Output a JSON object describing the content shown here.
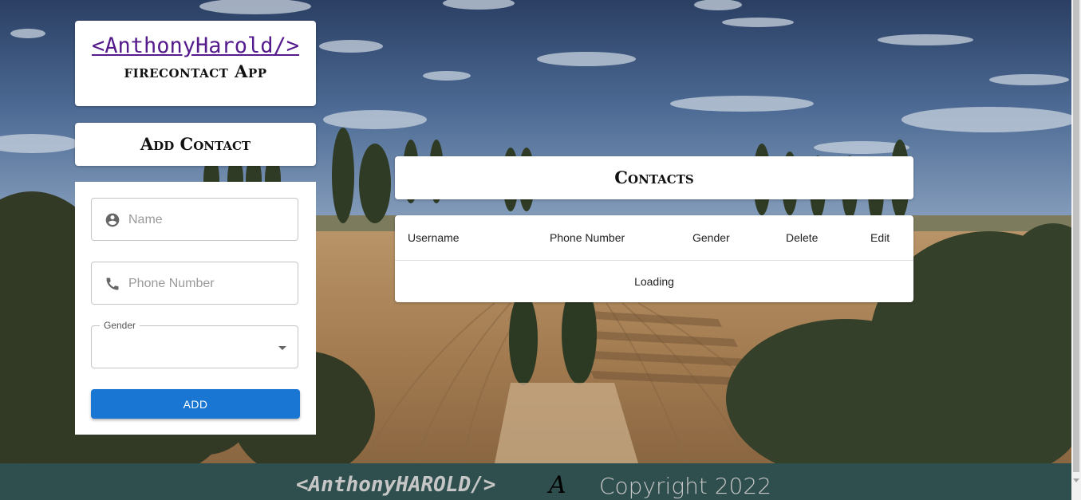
{
  "brand": {
    "logo_text": "<AnthonyHarold/>",
    "app_name": "firecontact App"
  },
  "add_contact": {
    "title": "Add Contact",
    "name_placeholder": "Name",
    "phone_placeholder": "Phone Number",
    "gender_label": "Gender",
    "gender_value": "",
    "add_button": "ADD"
  },
  "contacts": {
    "title": "Contacts",
    "columns": [
      "Username",
      "Phone Number",
      "Gender",
      "Delete",
      "Edit"
    ],
    "status": "Loading"
  },
  "footer": {
    "brand": "<AnthonyHAROLD/>",
    "logo_glyph": "A",
    "copyright": "Copyright 2022"
  },
  "colors": {
    "primary_button": "#1976d2",
    "footer_bg": "#2f4f4f",
    "link": "#551a8b"
  },
  "icons": {
    "name_field": "account-circle-icon",
    "phone_field": "phone-icon",
    "gender_select": "arrow-drop-down-icon"
  }
}
